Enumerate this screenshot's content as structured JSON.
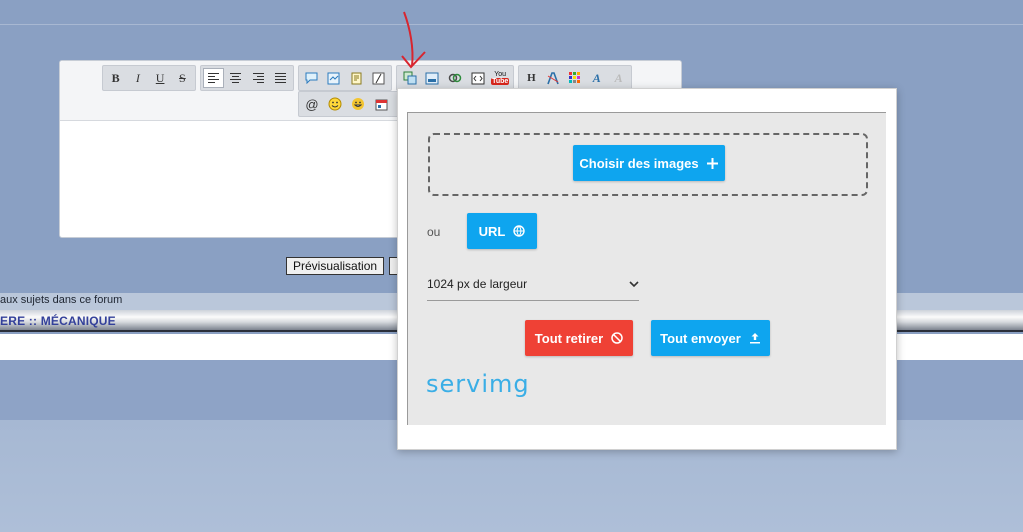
{
  "editor": {
    "toolbar_row1": {
      "format": [
        {
          "name": "bold",
          "glyph": "B"
        },
        {
          "name": "italic",
          "glyph": "I"
        },
        {
          "name": "underline",
          "glyph": "U"
        },
        {
          "name": "strike",
          "glyph": "S"
        }
      ]
    },
    "preview_label": "Prévisualisation"
  },
  "page": {
    "forum_text": "aux sujets dans ce forum",
    "breadcrumb": "ERE :: MÉCANIQUE"
  },
  "upload": {
    "choose_label": "Choisir des images",
    "or_label": "ou",
    "url_label": "URL",
    "size_option": "1024 px de largeur",
    "remove_all_label": "Tout retirer",
    "send_all_label": "Tout envoyer",
    "brand": "servimg",
    "colors": {
      "blue": "#0ea5ef",
      "red": "#ef4135"
    }
  }
}
